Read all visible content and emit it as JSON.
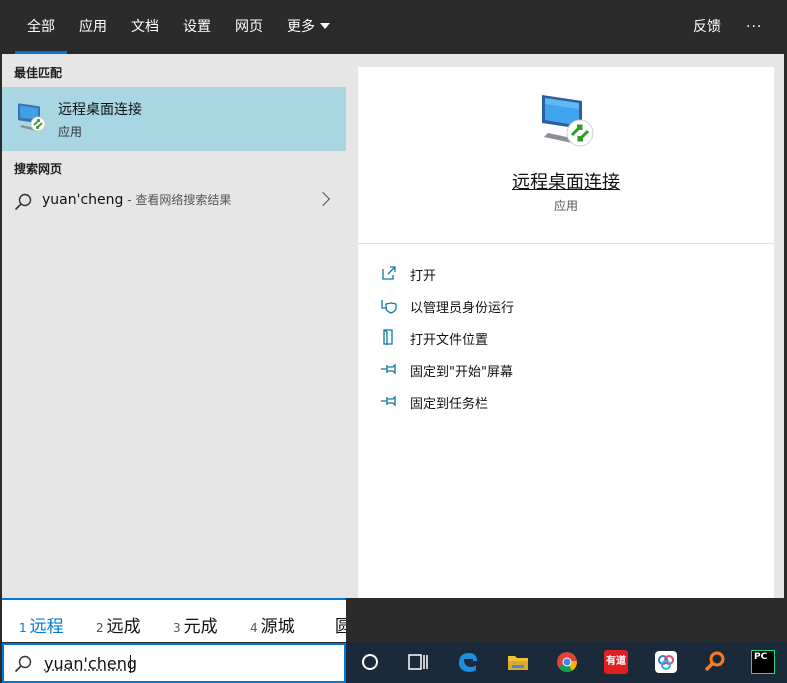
{
  "nav": {
    "tabs": [
      "全部",
      "应用",
      "文档",
      "设置",
      "网页",
      "更多"
    ],
    "feedback": "反馈",
    "more_dots": "···"
  },
  "left": {
    "best_match_label": "最佳匹配",
    "best_match": {
      "title": "远程桌面连接",
      "subtitle": "应用",
      "icon": "remote-desktop-icon"
    },
    "web_label": "搜索网页",
    "web_result": {
      "query": "yuan'cheng",
      "hint": " - 查看网络搜索结果"
    }
  },
  "detail": {
    "title": "远程桌面连接",
    "subtitle": "应用",
    "actions": [
      {
        "label": "打开",
        "icon": "open-icon"
      },
      {
        "label": "以管理员身份运行",
        "icon": "shield-icon"
      },
      {
        "label": "打开文件位置",
        "icon": "file-location-icon"
      },
      {
        "label": "固定到\"开始\"屏幕",
        "icon": "pin-icon"
      },
      {
        "label": "固定到任务栏",
        "icon": "pin-icon"
      }
    ]
  },
  "ime": {
    "candidates": [
      {
        "num": "1",
        "text": "远程"
      },
      {
        "num": "2",
        "text": "远成"
      },
      {
        "num": "3",
        "text": "元成"
      },
      {
        "num": "4",
        "text": "源城"
      },
      {
        "num": "",
        "text": "圆"
      }
    ]
  },
  "search": {
    "value": "yuan'cheng"
  },
  "taskbar": {
    "icons": [
      "cortana-icon",
      "task-view-icon",
      "edge-icon",
      "file-explorer-icon",
      "chrome-icon",
      "youdao-icon",
      "baidu-netdisk-icon",
      "search-tool-icon",
      "pycharm-icon"
    ],
    "youdao_label": "有道",
    "pycharm_label": "PC"
  },
  "colors": {
    "accent": "#0078d7",
    "selection": "#a8d6e3",
    "action_icon": "#0a7aa3"
  }
}
